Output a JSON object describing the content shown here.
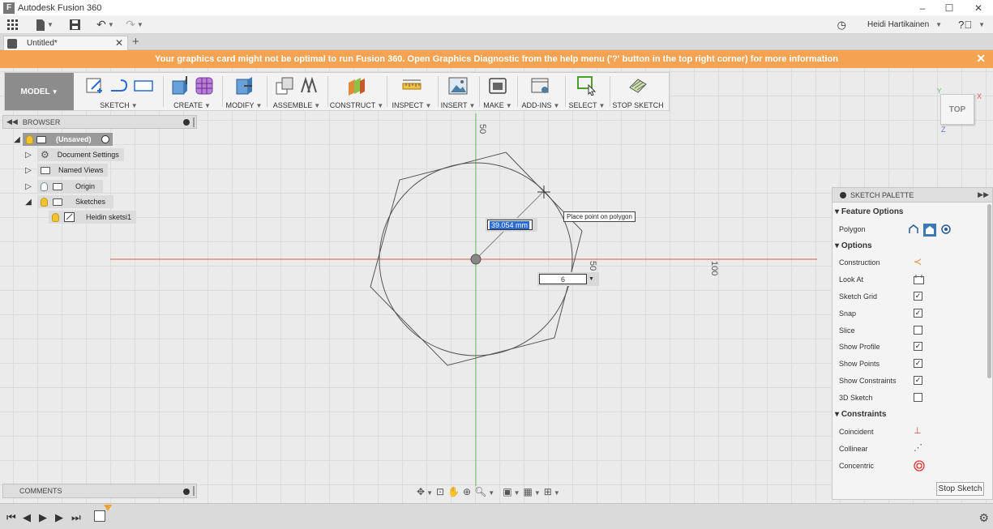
{
  "window": {
    "title": "Autodesk Fusion 360"
  },
  "quick_access": {
    "user_name": "Heidi Hartikainen"
  },
  "document_tab": {
    "name": "Untitled*"
  },
  "banner": {
    "message": "Your graphics card might not be optimal to run Fusion 360. Open Graphics Diagnostic from the help menu ('?' button in the top right corner) for more information"
  },
  "toolbar": {
    "workspace": "MODEL",
    "groups": [
      {
        "label": "SKETCH"
      },
      {
        "label": "CREATE"
      },
      {
        "label": "MODIFY"
      },
      {
        "label": "ASSEMBLE"
      },
      {
        "label": "CONSTRUCT"
      },
      {
        "label": "INSPECT"
      },
      {
        "label": "INSERT"
      },
      {
        "label": "MAKE"
      },
      {
        "label": "ADD-INS"
      },
      {
        "label": "SELECT"
      },
      {
        "label": "STOP SKETCH"
      }
    ]
  },
  "browser": {
    "title": "BROWSER",
    "items": [
      {
        "label": "(Unsaved)"
      },
      {
        "label": "Document Settings"
      },
      {
        "label": "Named Views"
      },
      {
        "label": "Origin"
      },
      {
        "label": "Sketches"
      },
      {
        "label": "Heidin sketsi1"
      }
    ]
  },
  "comments": {
    "title": "COMMENTS"
  },
  "viewcube": {
    "face": "TOP",
    "axis_x": "X",
    "axis_y": "Y",
    "axis_z": "Z"
  },
  "canvas": {
    "ruler_v_50": "50",
    "ruler_h_50": "50",
    "ruler_h_100": "100",
    "dimension_value": "39.054 mm",
    "sides_value": "6",
    "tooltip": "Place point on polygon"
  },
  "palette": {
    "title": "SKETCH PALETTE",
    "feature_options_header": "Feature Options",
    "polygon_label": "Polygon",
    "options_header": "Options",
    "options": [
      {
        "label": "Construction",
        "type": "icon"
      },
      {
        "label": "Look At",
        "type": "icon"
      },
      {
        "label": "Sketch Grid",
        "type": "check",
        "checked": true
      },
      {
        "label": "Snap",
        "type": "check",
        "checked": true
      },
      {
        "label": "Slice",
        "type": "check",
        "checked": false
      },
      {
        "label": "Show Profile",
        "type": "check",
        "checked": true
      },
      {
        "label": "Show Points",
        "type": "check",
        "checked": true
      },
      {
        "label": "Show Constraints",
        "type": "check",
        "checked": true
      },
      {
        "label": "3D Sketch",
        "type": "check",
        "checked": false
      }
    ],
    "constraints_header": "Constraints",
    "constraints": [
      {
        "label": "Coincident"
      },
      {
        "label": "Collinear"
      },
      {
        "label": "Concentric"
      }
    ],
    "stop_button": "Stop Sketch"
  },
  "colors": {
    "banner": "#f4a353",
    "accent": "#2a6ad3",
    "x_axis": "#e05555",
    "y_axis": "#60c060"
  }
}
